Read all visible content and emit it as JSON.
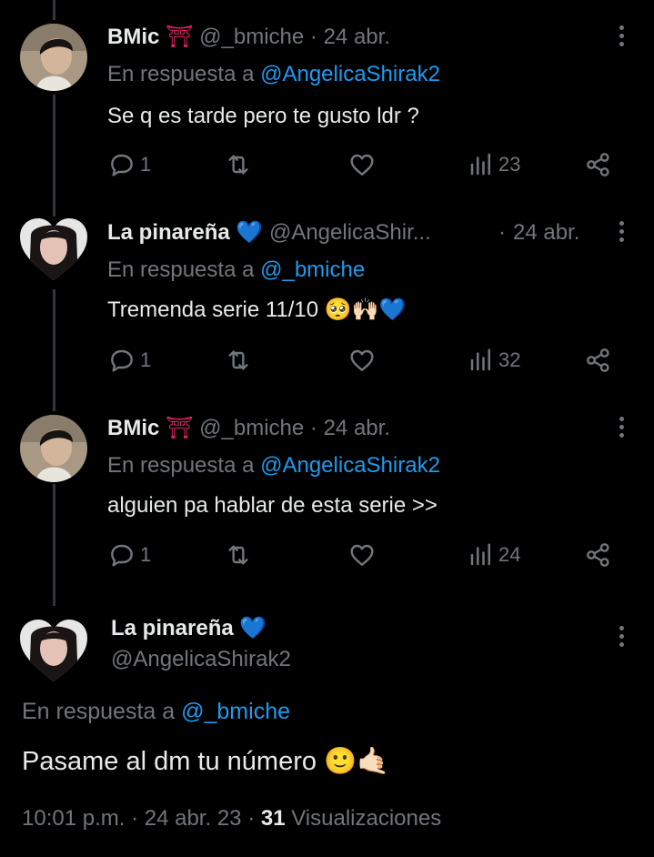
{
  "tweets": [
    {
      "name": "BMic",
      "name_emoji": "⛩",
      "handle": "@_bmiche",
      "sep": "·",
      "date": "24 abr.",
      "reply_prefix": "En respuesta a",
      "reply_to": "@AngelicaShirak2",
      "text": "Se q es tarde pero te gusto ldr ?",
      "replies": "1",
      "views": "23"
    },
    {
      "name": "La pinareña",
      "name_emoji": "💙",
      "handle": "@AngelicaShir...",
      "sep": "·",
      "date": "24 abr.",
      "reply_prefix": "En respuesta a",
      "reply_to": "@_bmiche",
      "text": "Tremenda serie 11/10",
      "text_emojis": "🥺🙌🏻💙",
      "replies": "1",
      "views": "32"
    },
    {
      "name": "BMic",
      "name_emoji": "⛩",
      "handle": "@_bmiche",
      "sep": "·",
      "date": "24 abr.",
      "reply_prefix": "En respuesta a",
      "reply_to": "@AngelicaShirak2",
      "text": "alguien pa hablar de esta serie >>",
      "replies": "1",
      "views": "24"
    }
  ],
  "main": {
    "name": "La pinareña",
    "name_emoji": "💙",
    "handle": "@AngelicaShirak2",
    "reply_prefix": "En respuesta a",
    "reply_to": "@_bmiche",
    "text": "Pasame al dm tu número",
    "text_emojis": "🙂🤙🏻",
    "time": "10:01 p.m.",
    "sep": "·",
    "date": "24 abr. 23",
    "sep2": "·",
    "views_count": "31",
    "views_label": "Visualizaciones"
  },
  "colors": {
    "background": "#000000",
    "text": "#e7e9ea",
    "muted": "#71767b",
    "link": "#1d9bf0",
    "heart_blue": "#1d9bf0"
  },
  "icons": {
    "reply": "reply-icon",
    "retweet": "retweet-icon",
    "like": "like-icon",
    "views": "views-icon",
    "share": "share-icon",
    "more": "more-icon"
  }
}
